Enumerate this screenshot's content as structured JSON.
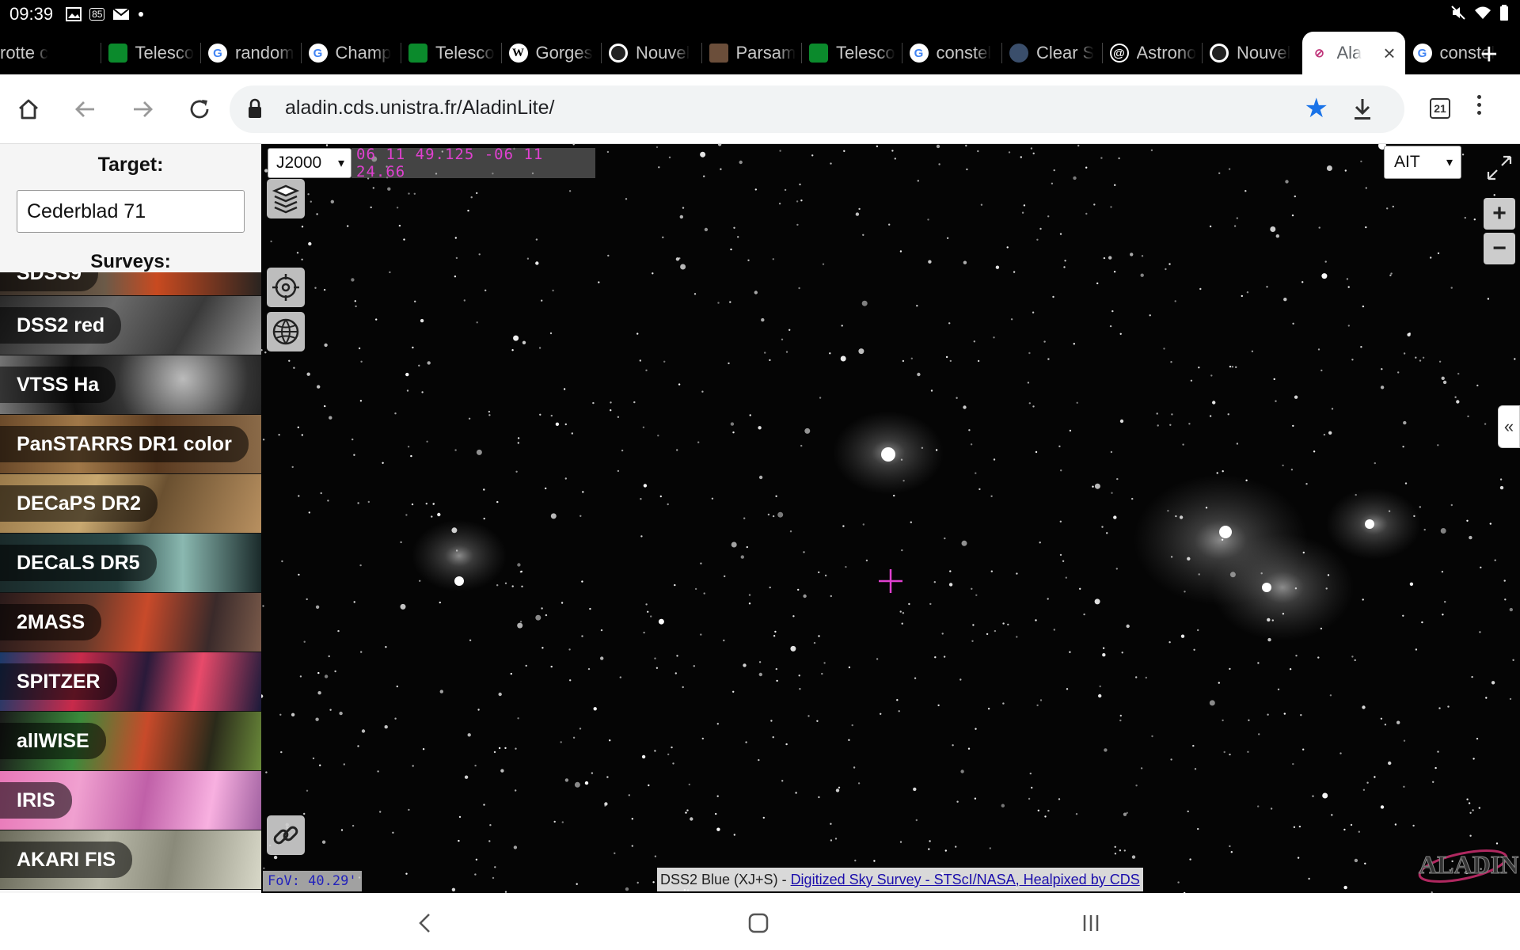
{
  "status_bar": {
    "time": "09:39",
    "left_icons": [
      "image-icon",
      "badge-85-icon",
      "mail-icon",
      "dot-icon"
    ],
    "right_icons": [
      "mute-icon",
      "wifi-icon",
      "battery-icon"
    ],
    "badge_text": "85"
  },
  "tabs": [
    {
      "title": "rotte c",
      "favicon": "none"
    },
    {
      "title": "Telesco",
      "favicon": "green-square-icon"
    },
    {
      "title": "random",
      "favicon": "google-icon"
    },
    {
      "title": "Champ",
      "favicon": "google-icon"
    },
    {
      "title": "Telesco",
      "favicon": "green-square-icon"
    },
    {
      "title": "Gorges",
      "favicon": "wikipedia-icon"
    },
    {
      "title": "Nouvel",
      "favicon": "chrome-icon"
    },
    {
      "title": "Parsam",
      "favicon": "photo-icon"
    },
    {
      "title": "Telesco",
      "favicon": "green-square-icon"
    },
    {
      "title": "constel",
      "favicon": "google-icon"
    },
    {
      "title": "Clear S",
      "favicon": "earth-icon"
    },
    {
      "title": "Astrono",
      "favicon": "spiral-icon"
    },
    {
      "title": "Nouvel",
      "favicon": "chrome-icon"
    },
    {
      "title": "Ala",
      "favicon": "aladin-icon",
      "active": true
    },
    {
      "title": "constel",
      "favicon": "google-icon"
    }
  ],
  "tab_favicon_letters": {
    "google": "G",
    "wiki": "W"
  },
  "new_tab_label": "+",
  "toolbar": {
    "url": "aladin.cds.unistra.fr/AladinLite/",
    "tab_count": "21",
    "bookmarked": true,
    "accent": "#1a73e8"
  },
  "sidebar": {
    "target_label": "Target:",
    "target_value": "Cederblad 71",
    "surveys_label": "Surveys:",
    "surveys": [
      {
        "name": "SDSS9",
        "partial": true,
        "bg": "linear-gradient(90deg,#3a3028,#6b5a48 40%,#c84a20 60%,#2a2420)"
      },
      {
        "name": "DSS2 red",
        "bg": "linear-gradient(120deg,#2a2a2a,#6a6a6a 40%,#3a3a3a 70%,#9a9a9a)"
      },
      {
        "name": "VTSS Ha",
        "bg": "radial-gradient(circle at 70% 40%,#bbb,#333 35%,#111 60%,#777)"
      },
      {
        "name": "PanSTARRS DR1 color",
        "bg": "linear-gradient(90deg,#6b4a2a,#a07848 30%,#5a3a20 60%,#8a6a48)"
      },
      {
        "name": "DECaPS DR2",
        "bg": "linear-gradient(110deg,#9a7a4a,#c8a870 35%,#6a5030 60%,#b89060)"
      },
      {
        "name": "DECaLS DR5",
        "bg": "linear-gradient(90deg,#1a2a2a,#2a4a48 45%,#8ab8b0 70%,#1a2a2a)"
      },
      {
        "name": "2MASS",
        "bg": "linear-gradient(100deg,#2a1a1a,#6a3a2a 35%,#c84a2a 55%,#3a2a2a 80%,#7a5a4a)"
      },
      {
        "name": "SPITZER",
        "bg": "linear-gradient(100deg,#1a3a6a,#c82a4a 30%,#2a1a3a 55%,#e84a6a 75%,#1a1a3a)"
      },
      {
        "name": "allWISE",
        "bg": "linear-gradient(100deg,#1a1a1a,#3a8a3a 30%,#c84a2a 55%,#2a2a1a 80%,#6a8a3a)"
      },
      {
        "name": "IRIS",
        "bg": "linear-gradient(100deg,#e878b8,#f0a0d0 30%,#c060a8 55%,#f8b0e0 80%,#a060a0)"
      },
      {
        "name": "AKARI FIS",
        "bg": "linear-gradient(100deg,#6a6a5a,#b8b8a8 40%,#8a8a7a 65%,#d8d8c8)"
      }
    ]
  },
  "viewer": {
    "frame": "J2000",
    "coordinates": "06 11 49.125 -06 11 24.66",
    "projection": "AIT",
    "fov": "FoV: 40.29'",
    "survey_attribution": "DSS2 Blue (XJ+S) -",
    "attribution_link": "Digitized Sky Survey - STScI/NASA, Healpixed by CDS",
    "logo_text": "ALADIN",
    "zoom_in": "+",
    "zoom_out": "−",
    "sidepanel_toggle": "«",
    "reticle_color": "#e040d0"
  }
}
